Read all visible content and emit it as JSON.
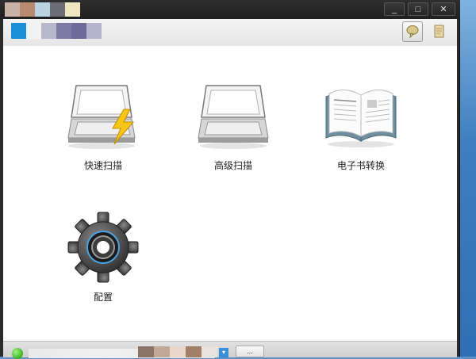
{
  "window": {
    "title_swatches": [
      "#c9b3a5",
      "#b88b70",
      "#bad3df",
      "#6c6c76",
      "#eee6c0"
    ],
    "controls": {
      "minimize": "_",
      "maximize": "□",
      "close": "✕"
    }
  },
  "toolbar": {
    "logo_swatches": [
      "#1a8ed6",
      "#f2f2f2",
      "#b8b8c9",
      "#7d7aa6",
      "#6f6a9a",
      "#b7b4d0"
    ],
    "help_icon": "speech-bubble-icon",
    "notes_icon": "notepad-icon"
  },
  "tiles": [
    {
      "label": "快速扫描",
      "icon": "quick-scan-icon"
    },
    {
      "label": "高级扫描",
      "icon": "advanced-scan-icon"
    },
    {
      "label": "电子书转换",
      "icon": "ebook-icon"
    },
    {
      "label": "配置",
      "icon": "gear-icon"
    }
  ],
  "status": {
    "indicator_color": "#35b320",
    "swatches": [
      "#8a7468",
      "#c2a898",
      "#e9d8c9",
      "#a47f67",
      "#e8e3dc"
    ],
    "more_label": "..."
  }
}
